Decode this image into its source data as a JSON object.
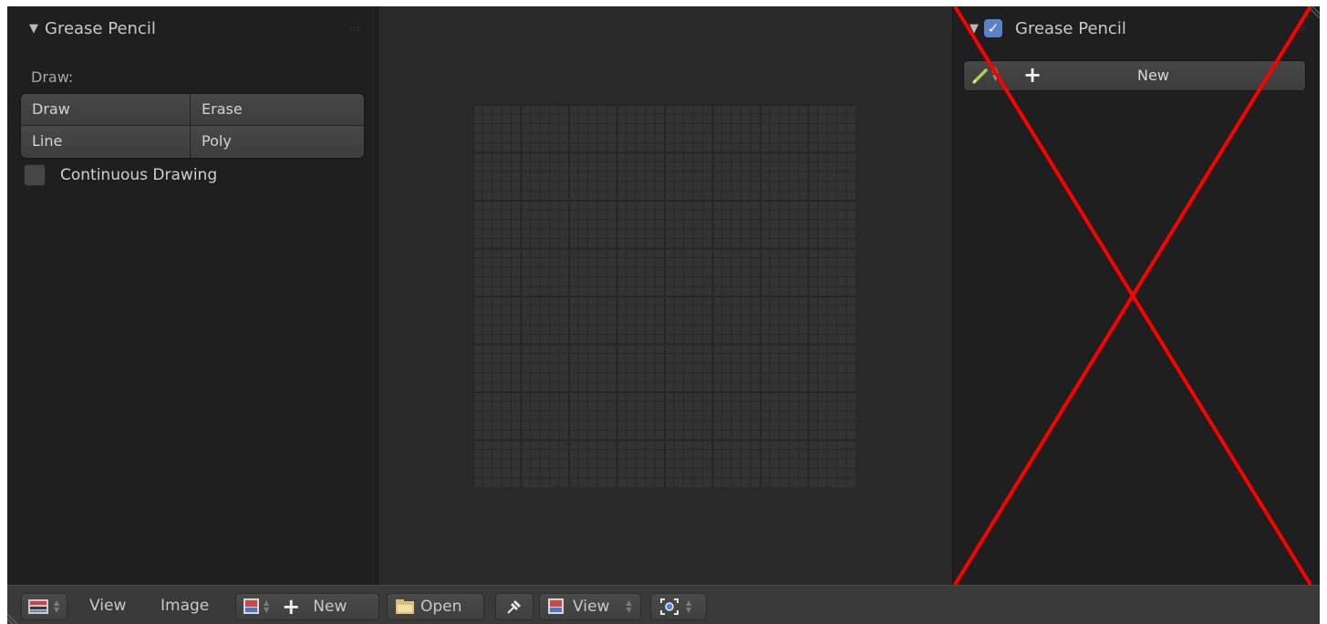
{
  "left_panel": {
    "title": "Grease Pencil",
    "draw_label": "Draw:",
    "buttons": [
      "Draw",
      "Erase",
      "Line",
      "Poly"
    ],
    "continuous_label": "Continuous Drawing"
  },
  "right_panel": {
    "title": "Grease Pencil",
    "new_label": "New",
    "annotation": "red-x-overlay"
  },
  "bottom_bar": {
    "view_label": "View",
    "image_label": "Image",
    "new_label": "New",
    "open_label": "Open",
    "view2_label": "View"
  },
  "colors": {
    "panel_bg": "#1f1f1f",
    "viewport_bg": "#2a2a2a",
    "header_bg": "#3a3a3a",
    "checkbox_blue": "#5b84c8",
    "annotation_red": "#ff0000"
  }
}
